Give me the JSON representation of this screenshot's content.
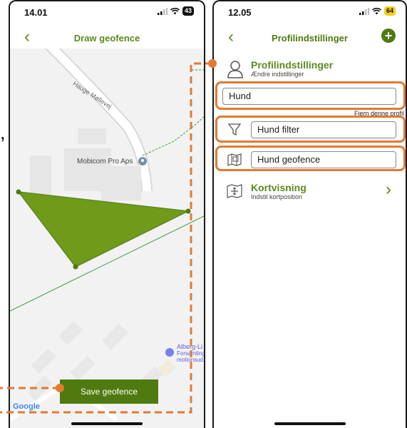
{
  "left_screen": {
    "status": {
      "time": "14.01",
      "battery": "43"
    },
    "nav": {
      "back": "‹",
      "title": "Draw geofence"
    },
    "map": {
      "road_label": "Hauge Møllevej",
      "poi_label": "Mobicom Pro Aps",
      "poi2_line1": "Alberg-Li",
      "poi2_line2": "Forsamlings",
      "poi2_line3": "motionsud",
      "google_label": "Google",
      "polygon_color": "#6f9a1a",
      "accent_color": "#4e7a0f"
    },
    "save_button": "Save geofence"
  },
  "right_screen": {
    "status": {
      "time": "12.05",
      "battery": "64"
    },
    "nav": {
      "back": "‹",
      "title": "Profilindstillinger",
      "add": "+"
    },
    "profile": {
      "title": "Profilindstillinger",
      "subtitle": "Ændre indstillinger"
    },
    "name_field": "Hund",
    "remove_link": "Fjern denne profil",
    "filter_field": "Hund filter",
    "geofence_field": "Hund geofence",
    "map_view": {
      "title": "Kortvisning",
      "subtitle": "Indstil kortposition",
      "chevron": "›"
    }
  },
  "annotation_color": "#e37a30",
  "left_margin_glyph": ","
}
